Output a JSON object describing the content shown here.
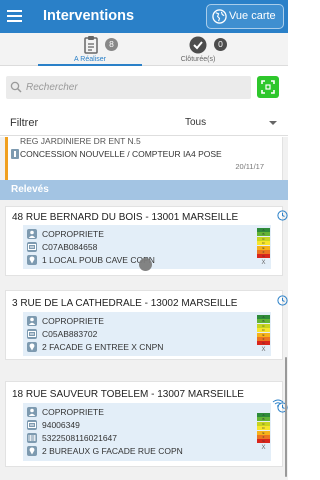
{
  "header": {
    "title": "Interventions",
    "map_button": "Vue carte"
  },
  "tabs": [
    {
      "label": "A Réaliser",
      "count": "8",
      "active": true,
      "icon": "clipboard-icon"
    },
    {
      "label": "Clôturée(s)",
      "count": "0",
      "active": false,
      "icon": "check-circle-icon"
    }
  ],
  "search": {
    "placeholder": "Rechercher",
    "value": ""
  },
  "filter": {
    "label": "Filtrer",
    "selected": "Tous"
  },
  "first_card": {
    "line1": "REG JARDINIERE DR ENT N.5",
    "line2": "CONCESSION NOUVELLE / COMPTEUR IA4 POSE",
    "date": "20/11/17"
  },
  "section": {
    "title": "Relevés"
  },
  "cards": [
    {
      "address": "48 RUE BERNARD DU BOIS - 13001 MARSEILLE",
      "rows": [
        {
          "icon": "user-icon",
          "text": "COPROPRIETE"
        },
        {
          "icon": "id-card-icon",
          "text": "C07AB084658"
        },
        {
          "icon": "location-pin-icon",
          "text": "1 LOCAL POUB CAVE COPN"
        }
      ]
    },
    {
      "address": "3 RUE DE LA CATHEDRALE - 13002 MARSEILLE",
      "rows": [
        {
          "icon": "user-icon",
          "text": "COPROPRIETE"
        },
        {
          "icon": "id-card-icon",
          "text": "C05AB883702"
        },
        {
          "icon": "location-pin-icon",
          "text": "2 FACADE G ENTREE X CNPN"
        }
      ]
    },
    {
      "address": "18 RUE SAUVEUR TOBELEM - 13007 MARSEILLE",
      "rows": [
        {
          "icon": "user-icon",
          "text": "COPROPRIETE"
        },
        {
          "icon": "id-card-icon",
          "text": "94006349"
        },
        {
          "icon": "barcode-icon",
          "text": "532250811602164​7"
        },
        {
          "icon": "location-pin-icon",
          "text": "2 BUREAUX G FACADE RUE COPN"
        }
      ]
    }
  ],
  "energy_classes": [
    "A",
    "B",
    "C",
    "D",
    "E",
    "F",
    "G"
  ],
  "energy_mark": "X",
  "colors": {
    "primary": "#2a80c8",
    "scan_button": "#2ec72c",
    "section_header": "#a3c4e3",
    "detail_background": "#e3eef8",
    "energy": [
      "#2e8b3a",
      "#63b335",
      "#c7d420",
      "#f6e62c",
      "#f5b21a",
      "#ec7420",
      "#d9251c"
    ]
  }
}
